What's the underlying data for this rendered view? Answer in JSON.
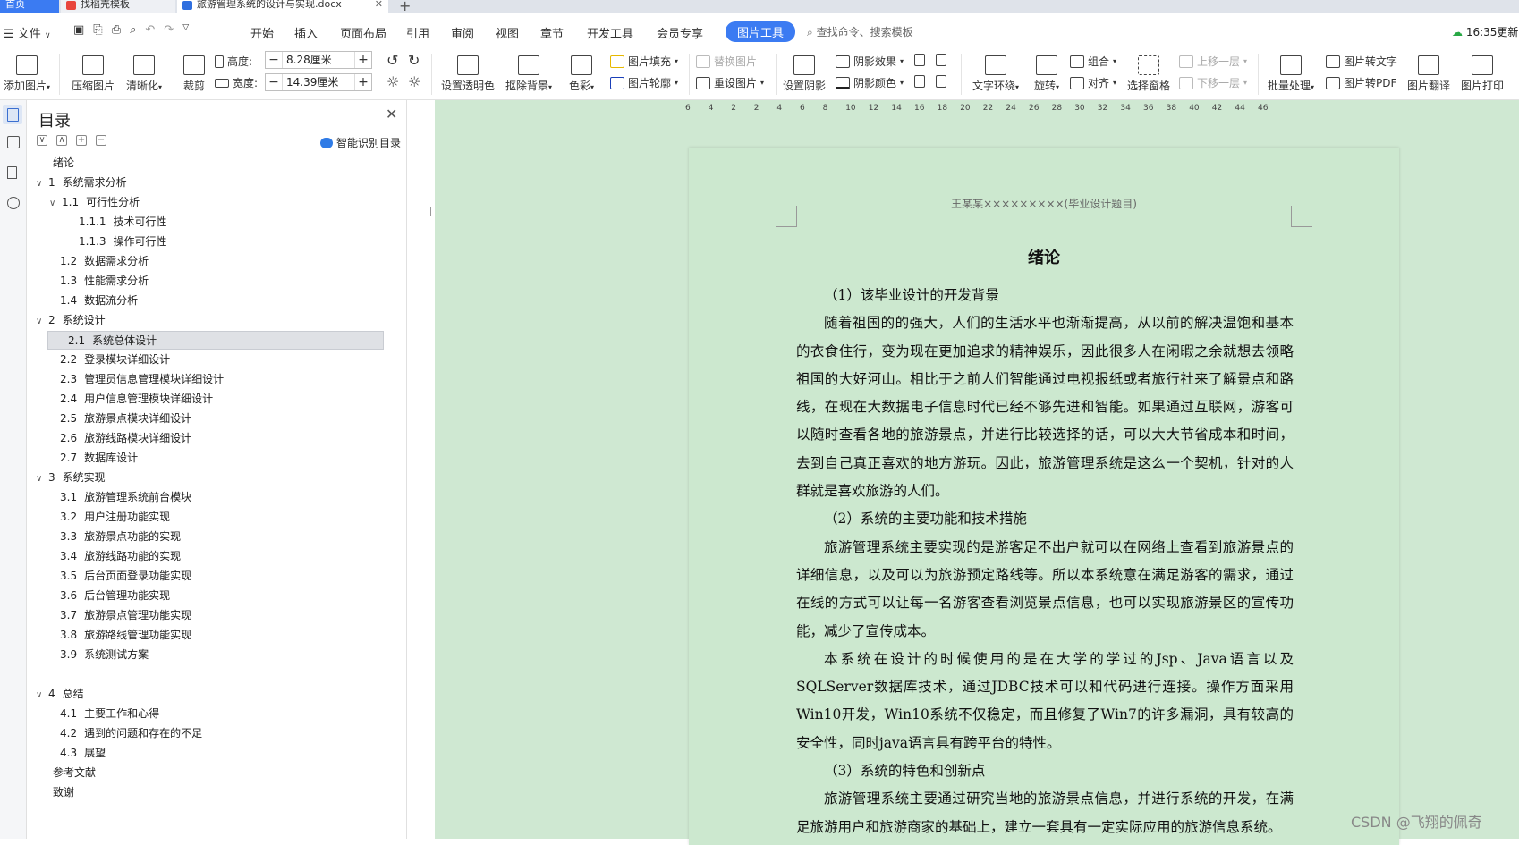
{
  "tabs": {
    "home": "首页",
    "template": "找稻壳模板",
    "document": "旅游管理系统的设计与实现.docx"
  },
  "menubar": {
    "file": "文件",
    "items": [
      "开始",
      "插入",
      "页面布局",
      "引用",
      "审阅",
      "视图",
      "章节",
      "开发工具",
      "会员专享"
    ],
    "active": "图片工具",
    "search": "查找命令、搜索模板",
    "time": "16:35更新"
  },
  "ribbon": {
    "add_image": "添加图片",
    "compress": "压缩图片",
    "sharpen": "清晰化",
    "crop": "裁剪",
    "height_label": "高度:",
    "height_value": "8.28厘米",
    "width_label": "宽度:",
    "width_value": "14.39厘米",
    "set_transparent": "设置透明色",
    "remove_bg": "抠除背景",
    "color": "色彩",
    "image_fill": "图片填充",
    "image_outline": "图片轮廓",
    "replace_image": "替换图片",
    "reset_image": "重设图片",
    "set_shadow": "设置阴影",
    "shadow_effect": "阴影效果",
    "shadow_color": "阴影颜色",
    "text_wrap": "文字环绕",
    "rotate": "旋转",
    "group": "组合",
    "align": "对齐",
    "select_pane": "选择窗格",
    "bring_forward": "上移一层",
    "send_backward": "下移一层",
    "batch": "批量处理",
    "to_text": "图片转文字",
    "to_pdf": "图片转PDF",
    "translate": "图片翻译",
    "print": "图片打印"
  },
  "toc": {
    "title": "目录",
    "smart_label": "智能识别目录",
    "items": [
      {
        "num": "",
        "text": "绪论",
        "caret": ""
      },
      {
        "num": "1",
        "text": "系统需求分析",
        "caret": "∨"
      },
      {
        "num": "1.1",
        "text": "可行性分析",
        "caret": "∨"
      },
      {
        "num": "1.1.1",
        "text": "技术可行性",
        "caret": ""
      },
      {
        "num": "1.1.3",
        "text": "操作可行性",
        "caret": ""
      },
      {
        "num": "1.2",
        "text": "数据需求分析",
        "caret": ""
      },
      {
        "num": "1.3",
        "text": "性能需求分析",
        "caret": ""
      },
      {
        "num": "1.4",
        "text": "数据流分析",
        "caret": ""
      },
      {
        "num": "2",
        "text": "系统设计",
        "caret": "∨"
      },
      {
        "num": "2.1",
        "text": "系统总体设计",
        "caret": ""
      },
      {
        "num": "2.2",
        "text": "登录模块详细设计",
        "caret": ""
      },
      {
        "num": "2.3",
        "text": "管理员信息管理模块详细设计",
        "caret": ""
      },
      {
        "num": "2.4",
        "text": "用户信息管理模块详细设计",
        "caret": ""
      },
      {
        "num": "2.5",
        "text": "旅游景点模块详细设计",
        "caret": ""
      },
      {
        "num": "2.6",
        "text": "旅游线路模块详细设计",
        "caret": ""
      },
      {
        "num": "2.7",
        "text": "数据库设计",
        "caret": ""
      },
      {
        "num": "3",
        "text": "系统实现",
        "caret": "∨"
      },
      {
        "num": "3.1",
        "text": "旅游管理系统前台模块",
        "caret": ""
      },
      {
        "num": "3.2",
        "text": "用户注册功能实现",
        "caret": ""
      },
      {
        "num": "3.3",
        "text": "旅游景点功能的实现",
        "caret": ""
      },
      {
        "num": "3.4",
        "text": "旅游线路功能的实现",
        "caret": ""
      },
      {
        "num": "3.5",
        "text": "后台页面登录功能实现",
        "caret": ""
      },
      {
        "num": "3.6",
        "text": "后台管理功能实现",
        "caret": ""
      },
      {
        "num": "3.7",
        "text": "旅游景点管理功能实现",
        "caret": ""
      },
      {
        "num": "3.8",
        "text": "旅游路线管理功能实现",
        "caret": ""
      },
      {
        "num": "3.9",
        "text": "系统测试方案",
        "caret": ""
      },
      {
        "num": "4",
        "text": "总结",
        "caret": "∨"
      },
      {
        "num": "4.1",
        "text": "主要工作和心得",
        "caret": ""
      },
      {
        "num": "4.2",
        "text": "遇到的问题和存在的不足",
        "caret": ""
      },
      {
        "num": "4.3",
        "text": "展望",
        "caret": ""
      },
      {
        "num": "",
        "text": "参考文献",
        "caret": ""
      },
      {
        "num": "",
        "text": "致谢",
        "caret": ""
      }
    ],
    "selected": "2.1"
  },
  "ruler": [
    "6",
    "4",
    "2",
    "2",
    "4",
    "6",
    "8",
    "10",
    "12",
    "14",
    "16",
    "18",
    "20",
    "22",
    "24",
    "26",
    "28",
    "30",
    "32",
    "34",
    "36",
    "38",
    "40",
    "42",
    "44",
    "46"
  ],
  "document": {
    "header": "王某某×××××××××(毕业设计题目)",
    "title": "绪论",
    "paragraphs": [
      "（1）该毕业设计的开发背景",
      "随着祖国的的强大，人们的生活水平也渐渐提高，从以前的解决温饱和基本的衣食住行，变为现在更加追求的精神娱乐，因此很多人在闲暇之余就想去领略祖国的大好河山。相比于之前人们智能通过电视报纸或者旅行社来了解景点和路线，在现在大数据电子信息时代已经不够先进和智能。如果通过互联网，游客可以随时查看各地的旅游景点，并进行比较选择的话，可以大大节省成本和时间，去到自己真正喜欢的地方游玩。因此，旅游管理系统是这么一个契机，针对的人群就是喜欢旅游的人们。",
      "（2）系统的主要功能和技术措施",
      "旅游管理系统主要实现的是游客足不出户就可以在网络上查看到旅游景点的详细信息，以及可以为旅游预定路线等。所以本系统意在满足游客的需求，通过在线的方式可以让每一名游客查看浏览景点信息，也可以实现旅游景区的宣传功能，减少了宣传成本。",
      "本系统在设计的时候使用的是在大学的学过的Jsp、Java语言以及SQLServer数据库技术，通过JDBC技术可以和代码进行连接。操作方面采用Win10开发，Win10系统不仅稳定，而且修复了Win7的许多漏洞，具有较高的安全性，同时java语言具有跨平台的特性。",
      "（3）系统的特色和创新点",
      "旅游管理系统主要通过研究当地的旅游景点信息，并进行系统的开发，在满足旅游用户和旅游商家的基础上，建立一套具有一定实际应用的旅游信息系统。"
    ]
  },
  "watermark": "CSDN @飞翔的佩奇"
}
